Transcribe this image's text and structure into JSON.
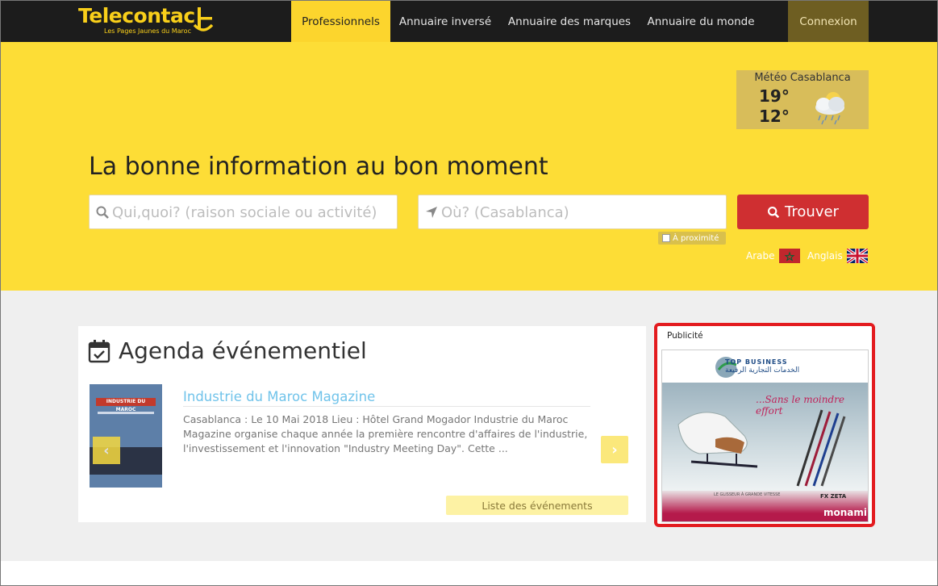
{
  "header": {
    "logo_text": "Telecontac",
    "logo_tagline": "Les Pages Jaunes du Maroc",
    "nav": {
      "professionnels": "Professionnels",
      "annuaire_inverse": "Annuaire inversé",
      "annuaire_marques": "Annuaire des marques",
      "annuaire_monde": "Annuaire du monde",
      "connexion": "Connexion"
    }
  },
  "weather": {
    "title": "Météo Casablanca",
    "high": "19°",
    "low": "12°",
    "icon": "cloud-rain-sun-icon"
  },
  "hero": {
    "title": "La bonne information au bon moment",
    "search_what_placeholder": "Qui,quoi? (raison sociale ou activité)",
    "search_where_placeholder": "Où? (Casablanca)",
    "search_button": "Trouver",
    "proximity_label": "À proximité",
    "lang_arabic": "Arabe",
    "lang_english": "Anglais"
  },
  "agenda": {
    "title": "Agenda événementiel",
    "event": {
      "title": "Industrie du Maroc Magazine",
      "description": "Casablanca : Le 10 Mai 2018 Lieu : Hôtel  Grand Mogador Industrie du Maroc Magazine organise chaque année la première rencontre d'affaires de l'industrie, l'investissement et l'innovation \"Industry Meeting Day\". Cette ...",
      "image_banner": "INDUSTRIE DU MAROC"
    },
    "list_button": "Liste des événements"
  },
  "ad": {
    "label": "Publicité",
    "top_title": "TOP BUSINESS",
    "top_arabic": "الخدمات التجارية الرفيعة",
    "slogan": "...Sans le moindre effort",
    "caption": "LE GLISSEUR À GRANDE VITESSE",
    "fx": "FX ZETA",
    "brand": "monami"
  },
  "colors": {
    "yellow": "#fddd36",
    "nav_bg": "#1c1c1c",
    "button_red": "#cf2f31",
    "ad_border": "#e31b1f",
    "link_blue": "#70c3ea"
  }
}
